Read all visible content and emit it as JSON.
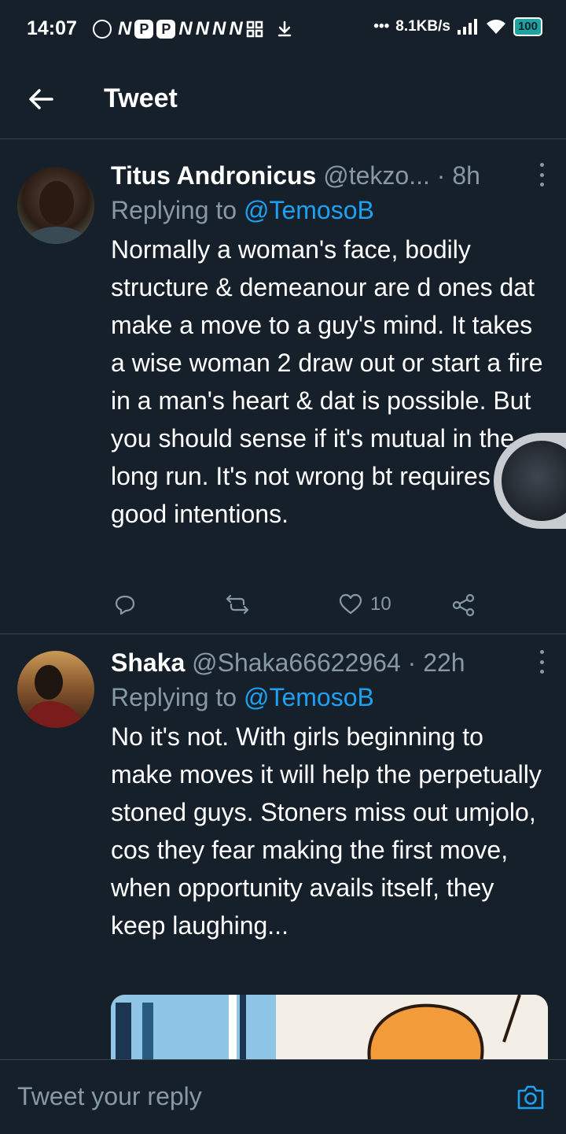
{
  "status_bar": {
    "time": "14:07",
    "network_speed": "8.1KB/s",
    "battery": "100",
    "notification_letters": [
      "N",
      "P",
      "P",
      "N",
      "N",
      "N",
      "N"
    ]
  },
  "header": {
    "title": "Tweet"
  },
  "tweets": [
    {
      "name": "Titus Andronicus",
      "handle": "@tekzo...",
      "separator": "·",
      "time": "8h",
      "reply_prefix": "Replying to",
      "reply_to": "@TemosoB",
      "text": "Normally a woman's face, bodily structure & demeanour are d ones dat make a move to a guy's mind. It takes a wise woman 2 draw out or start a fire in a man's heart & dat is possible. But you should sense if it's mutual in the long run. It's not wrong bt requires good intentions.",
      "likes": "10"
    },
    {
      "name": "Shaka",
      "handle": "@Shaka66622964",
      "separator": "·",
      "time": "22h",
      "reply_prefix": "Replying to",
      "reply_to": "@TemosoB",
      "text": "No it's not. With girls beginning to make moves it will help the perpetually stoned guys. Stoners miss out umjolo, cos they fear making the first move, when opportunity avails itself, they keep laughing..."
    }
  ],
  "reply_bar": {
    "placeholder": "Tweet your reply"
  },
  "colors": {
    "background": "#15202b",
    "accent": "#1da1f2",
    "muted": "#8899a6",
    "divider": "#38444d"
  }
}
